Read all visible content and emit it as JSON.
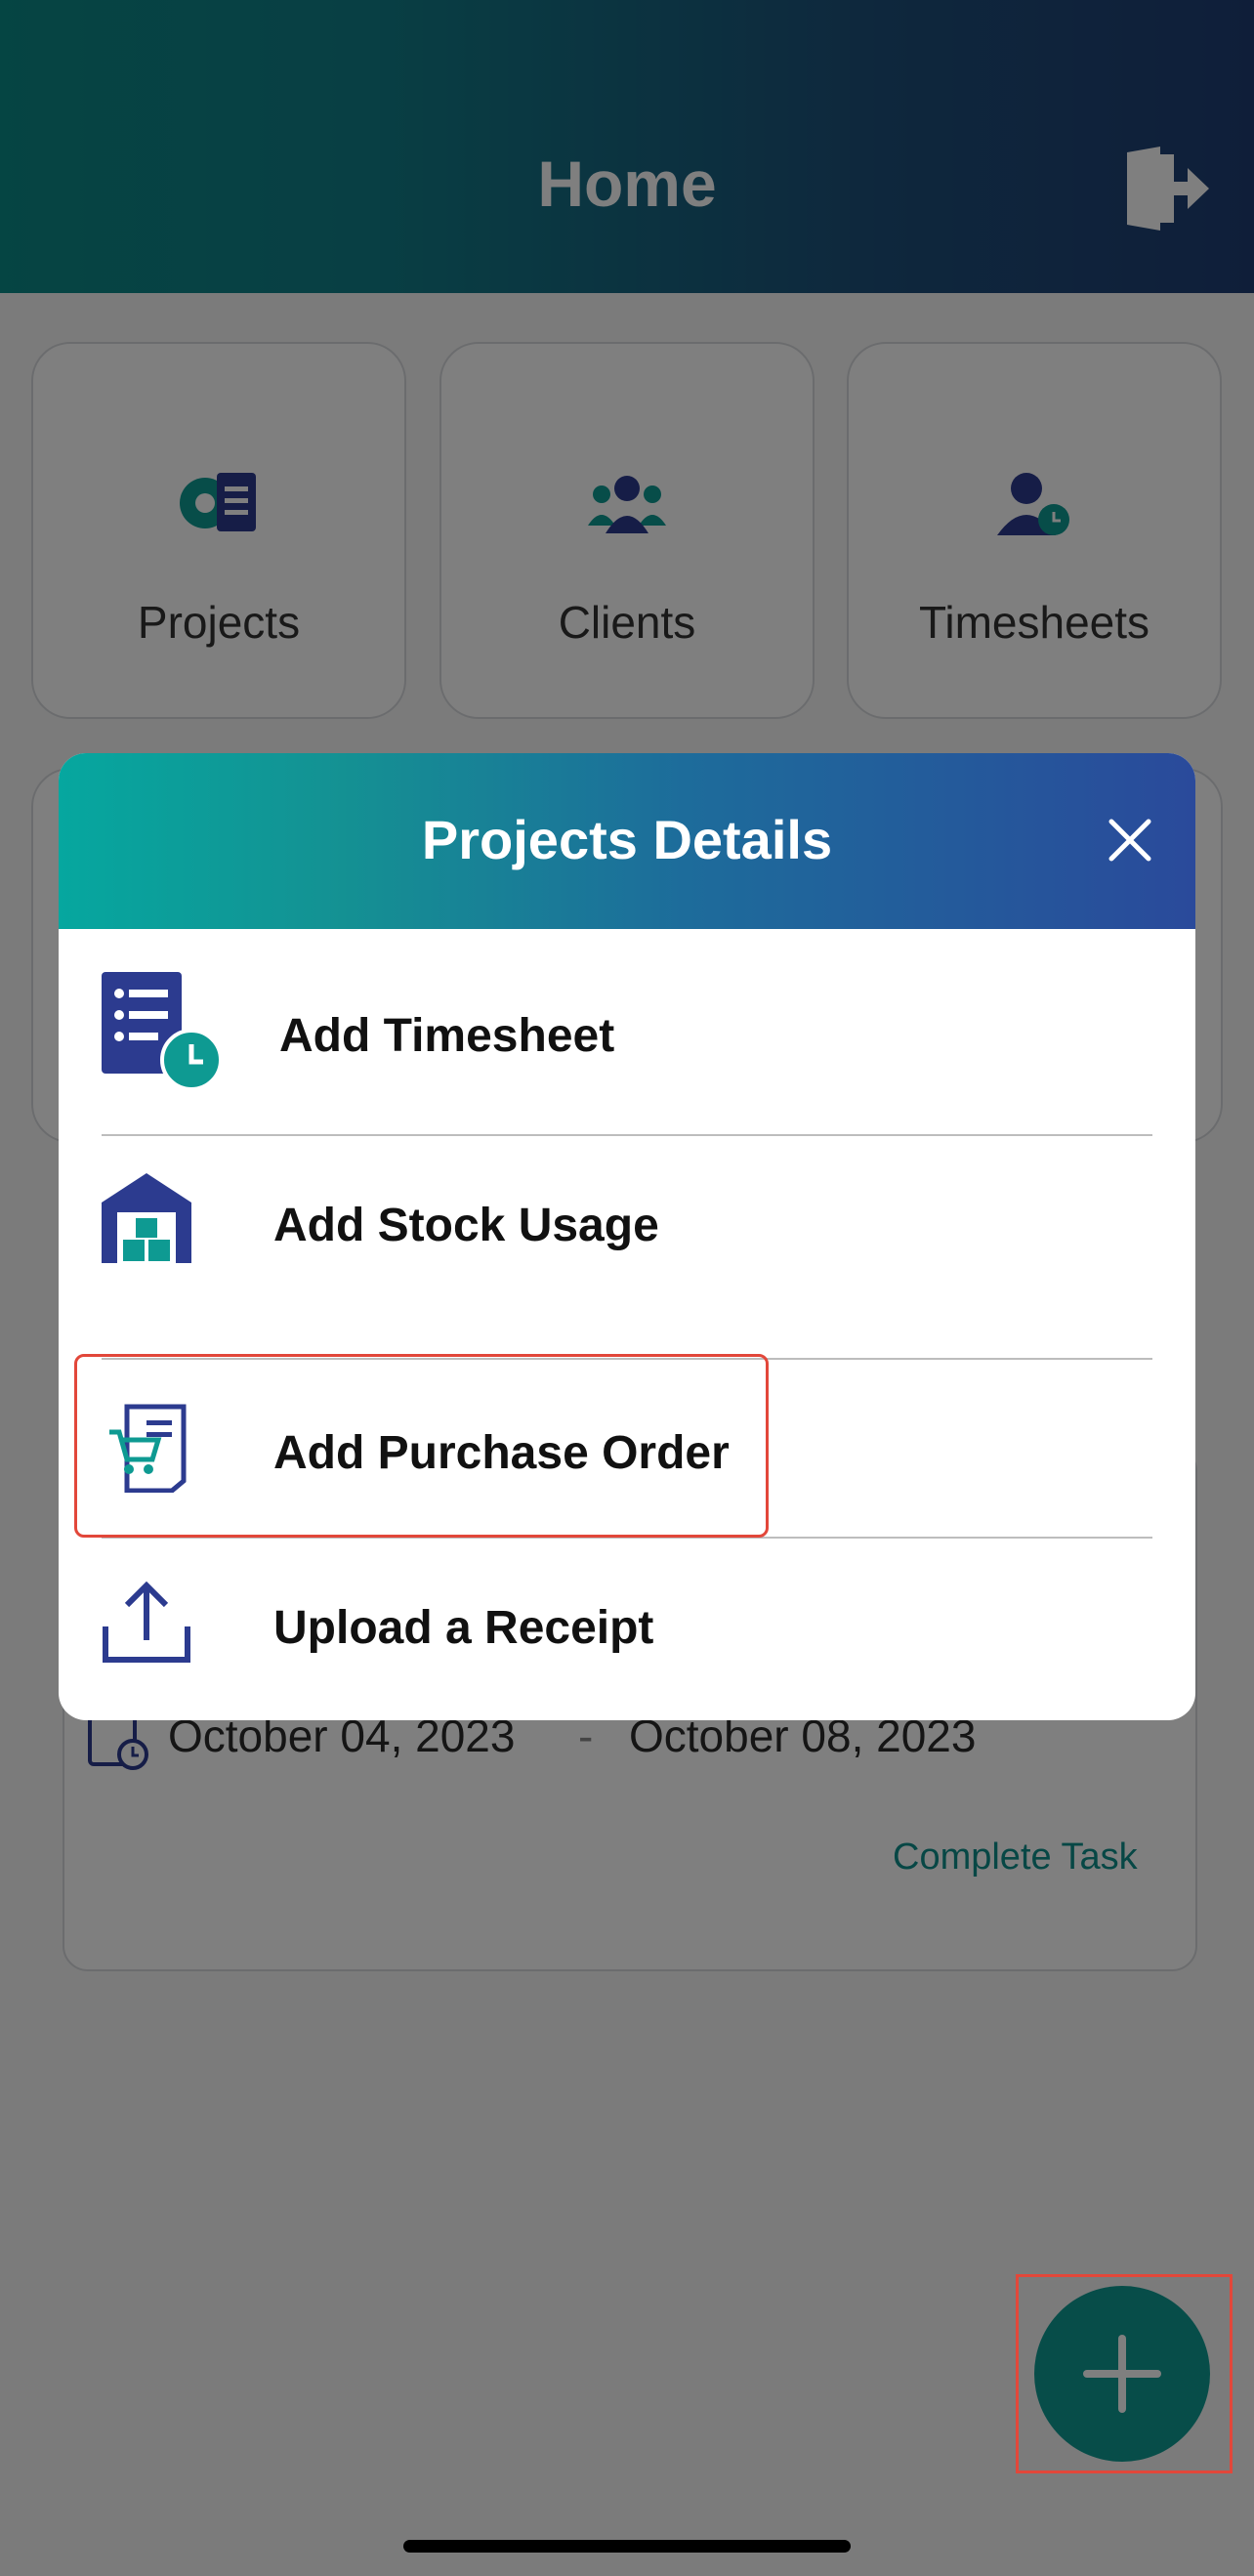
{
  "header": {
    "title": "Home"
  },
  "tiles": [
    {
      "label": "Projects",
      "icon": "projects-gear-document-icon"
    },
    {
      "label": "Clients",
      "icon": "clients-group-icon"
    },
    {
      "label": "Timesheets",
      "icon": "timesheets-user-clock-icon"
    }
  ],
  "task_card": {
    "start_date": "October 04, 2023",
    "separator": "-",
    "end_date": "October 08, 2023",
    "action_label": "Complete Task"
  },
  "modal": {
    "title": "Projects Details",
    "items": [
      {
        "label": "Add Timesheet",
        "icon": "timesheet-document-clock-icon"
      },
      {
        "label": "Add Stock Usage",
        "icon": "warehouse-icon"
      },
      {
        "label": "Add Purchase Order",
        "icon": "purchase-order-cart-icon"
      },
      {
        "label": "Upload a Receipt",
        "icon": "upload-icon"
      }
    ]
  },
  "colors": {
    "teal": "#0e9a92",
    "navy": "#2c3b8f",
    "highlight": "#e2473a"
  }
}
